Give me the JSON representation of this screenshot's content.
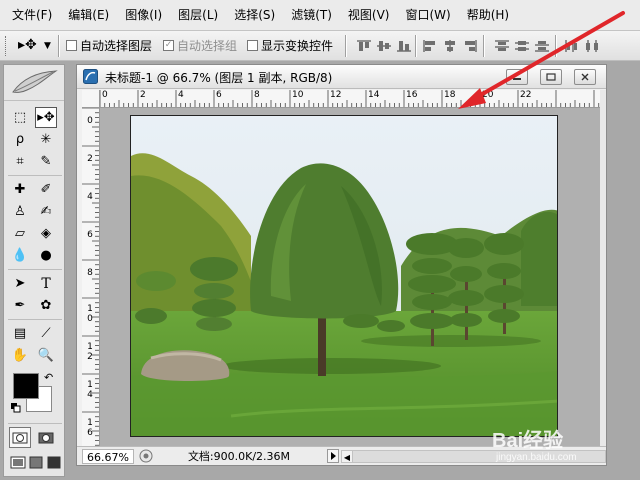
{
  "menu": {
    "items": [
      "文件(F)",
      "编辑(E)",
      "图像(I)",
      "图层(L)",
      "选择(S)",
      "滤镜(T)",
      "视图(V)",
      "窗口(W)",
      "帮助(H)"
    ]
  },
  "options_bar": {
    "tool_preset_icon": "move-tool-icon",
    "auto_select_layer": {
      "label": "自动选择图层",
      "checked": false
    },
    "auto_select_group": {
      "label": "自动选择组",
      "checked": true,
      "disabled": true
    },
    "show_transform": {
      "label": "显示变换控件",
      "checked": false
    },
    "align_icons": [
      "align-top-icon",
      "align-vcenter-icon",
      "align-bottom-icon",
      "align-left-icon",
      "align-hcenter-icon",
      "align-right-icon",
      "distribute-top-icon",
      "distribute-vcenter-icon",
      "distribute-bottom-icon",
      "distribute-left-icon"
    ]
  },
  "toolbox": {
    "header_icon": "feather-icon",
    "tools": [
      "marquee-tool-icon",
      "move-tool-icon",
      "lasso-tool-icon",
      "magic-wand-tool-icon",
      "crop-tool-icon",
      "slice-tool-icon",
      "healing-brush-tool-icon",
      "brush-tool-icon",
      "clone-stamp-tool-icon",
      "history-brush-tool-icon",
      "eraser-tool-icon",
      "paint-bucket-tool-icon",
      "blur-tool-icon",
      "dodge-tool-icon",
      "path-selection-tool-icon",
      "type-tool-icon",
      "pen-tool-icon",
      "custom-shape-tool-icon",
      "notes-tool-icon",
      "eyedropper-tool-icon",
      "hand-tool-icon",
      "zoom-tool-icon"
    ],
    "type_tool_glyph": "T",
    "foreground_color": "#000000",
    "background_color": "#ffffff"
  },
  "document": {
    "title": "未标题-1 @ 66.7% (图层 1 副本, RGB/8)",
    "ruler_h": [
      "0",
      "2",
      "4",
      "6",
      "8",
      "10",
      "12",
      "14",
      "16",
      "18",
      "20",
      "22"
    ],
    "ruler_v": [
      [
        "0"
      ],
      [
        "2"
      ],
      [
        "4"
      ],
      [
        "6"
      ],
      [
        "8"
      ],
      [
        "1",
        "0"
      ],
      [
        "1",
        "2"
      ],
      [
        "1",
        "4"
      ],
      [
        "1",
        "6"
      ]
    ],
    "zoom": "66.67%",
    "doc_info": "文档:900.0K/2.36M"
  },
  "watermark": {
    "text": "Bai经验",
    "sub": "jingyan.baidu.com"
  },
  "colors": {
    "annotation_arrow": "#e0262a",
    "sky": "#e6eef4",
    "grass": "#5f9a32"
  }
}
